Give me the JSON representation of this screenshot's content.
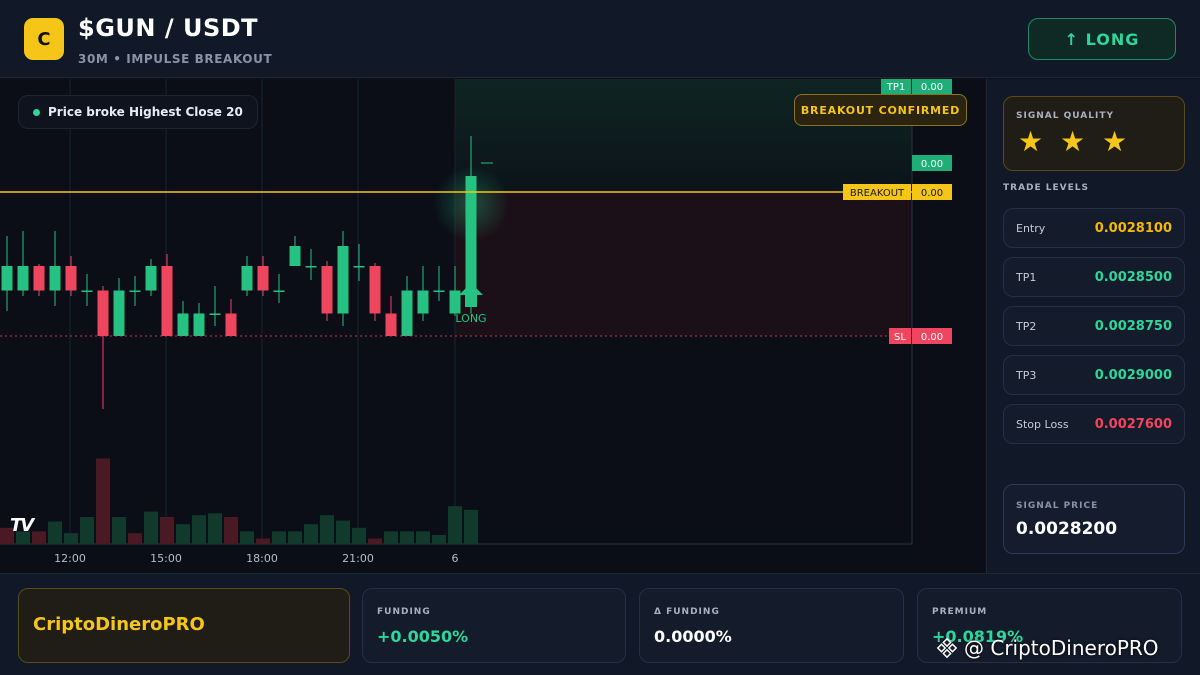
{
  "header": {
    "logo_letter": "C",
    "pair": "$GUN / USDT",
    "subtitle": "30M • IMPULSE BREAKOUT",
    "direction_button": "↑ LONG"
  },
  "chart": {
    "info_pill": "Price broke Highest Close 20",
    "badge": "BREAKOUT CONFIRMED",
    "signal_arrow_label": "LONG",
    "tv_logo": "TV",
    "price_tags": [
      {
        "label": "TP1",
        "value": "0.00"
      },
      {
        "label": "",
        "value": "0.00"
      },
      {
        "label": "BREAKOUT",
        "value": "0.00"
      },
      {
        "label": "SL",
        "value": "0.00"
      }
    ],
    "time_labels": [
      "12:00",
      "15:00",
      "18:00",
      "21:00",
      "6"
    ],
    "colors": {
      "up": "#26c281",
      "down": "#f0455f",
      "breakout": "#f5c518"
    }
  },
  "chart_data": {
    "type": "candlestick",
    "x_labels": [
      "12:00",
      "15:00",
      "18:00",
      "21:00",
      "6"
    ],
    "candles": [
      {
        "o": 0.455,
        "c": 0.7,
        "h": 1.0,
        "l": 0.25
      },
      {
        "o": 0.455,
        "c": 0.7,
        "h": 1.05,
        "l": 0.4
      },
      {
        "o": 0.7,
        "c": 0.455,
        "h": 0.72,
        "l": 0.4
      },
      {
        "o": 0.455,
        "c": 0.7,
        "h": 1.05,
        "l": 0.3
      },
      {
        "o": 0.7,
        "c": 0.455,
        "h": 0.8,
        "l": 0.4
      },
      {
        "o": 0.455,
        "c": 0.455,
        "h": 0.62,
        "l": 0.3
      },
      {
        "o": 0.455,
        "c": 0.0,
        "h": 0.5,
        "l": -0.73
      },
      {
        "o": 0.0,
        "c": 0.455,
        "h": 0.58,
        "l": 0.0
      },
      {
        "o": 0.455,
        "c": 0.455,
        "h": 0.6,
        "l": 0.3
      },
      {
        "o": 0.455,
        "c": 0.7,
        "h": 0.77,
        "l": 0.4
      },
      {
        "o": 0.7,
        "c": 0.0,
        "h": 0.82,
        "l": 0.0
      },
      {
        "o": 0.0,
        "c": 0.225,
        "h": 0.35,
        "l": 0.0
      },
      {
        "o": 0.0,
        "c": 0.225,
        "h": 0.33,
        "l": 0.0
      },
      {
        "o": 0.225,
        "c": 0.225,
        "h": 0.5,
        "l": 0.1
      },
      {
        "o": 0.225,
        "c": 0.0,
        "h": 0.37,
        "l": 0.0
      },
      {
        "o": 0.455,
        "c": 0.7,
        "h": 0.8,
        "l": 0.4
      },
      {
        "o": 0.7,
        "c": 0.455,
        "h": 0.8,
        "l": 0.4
      },
      {
        "o": 0.455,
        "c": 0.455,
        "h": 0.62,
        "l": 0.33
      },
      {
        "o": 0.7,
        "c": 0.9,
        "h": 1.0,
        "l": 0.7
      },
      {
        "o": 0.7,
        "c": 0.7,
        "h": 0.87,
        "l": 0.56
      },
      {
        "o": 0.7,
        "c": 0.225,
        "h": 0.75,
        "l": 0.15
      },
      {
        "o": 0.225,
        "c": 0.9,
        "h": 1.05,
        "l": 0.1
      },
      {
        "o": 0.7,
        "c": 0.7,
        "h": 0.92,
        "l": 0.55
      },
      {
        "o": 0.7,
        "c": 0.225,
        "h": 0.73,
        "l": 0.15
      },
      {
        "o": 0.225,
        "c": 0.0,
        "h": 0.4,
        "l": 0.0
      },
      {
        "o": 0.0,
        "c": 0.455,
        "h": 0.6,
        "l": 0.0
      },
      {
        "o": 0.225,
        "c": 0.455,
        "h": 0.7,
        "l": 0.15
      },
      {
        "o": 0.455,
        "c": 0.455,
        "h": 0.7,
        "l": 0.35
      },
      {
        "o": 0.225,
        "c": 0.455,
        "h": 0.7,
        "l": 0.2
      },
      {
        "o": 0.455,
        "c": 1.6,
        "h": 2.0,
        "l": 0.225
      }
    ],
    "volume": [
      0.18,
      0.14,
      0.14,
      0.25,
      0.12,
      0.3,
      0.95,
      0.3,
      0.12,
      0.36,
      0.3,
      0.22,
      0.32,
      0.34,
      0.3,
      0.14,
      0.06,
      0.14,
      0.14,
      0.22,
      0.32,
      0.26,
      0.18,
      0.06,
      0.14,
      0.14,
      0.14,
      0.1,
      0.42,
      0.38
    ],
    "volume_dir": [
      "down",
      "up",
      "down",
      "up",
      "up",
      "up",
      "down",
      "up",
      "down",
      "up",
      "down",
      "up",
      "up",
      "up",
      "down",
      "up",
      "down",
      "up",
      "up",
      "up",
      "up",
      "up",
      "up",
      "down",
      "up",
      "up",
      "up",
      "up",
      "up",
      "up"
    ]
  },
  "panel": {
    "quality_label": "SIGNAL QUALITY",
    "stars": "★ ★ ★",
    "trade_levels_title": "TRADE LEVELS",
    "levels": [
      {
        "label": "Entry",
        "value": "0.0028100",
        "color": "#f5b800"
      },
      {
        "label": "TP1",
        "value": "0.0028500",
        "color": "#2ed699"
      },
      {
        "label": "TP2",
        "value": "0.0028750",
        "color": "#2ed699"
      },
      {
        "label": "TP3",
        "value": "0.0029000",
        "color": "#2ed699"
      },
      {
        "label": "Stop Loss",
        "value": "0.0027600",
        "color": "#f0455f"
      }
    ],
    "signal_price_label": "SIGNAL PRICE",
    "signal_price_value": "0.0028200"
  },
  "footer": {
    "brand": "CriptoDineroPRO",
    "stats": [
      {
        "label": "FUNDING",
        "value": "+0.0050%",
        "color": "#2ed699"
      },
      {
        "label": "Δ FUNDING",
        "value": "0.0000%",
        "color": "#ffffff"
      },
      {
        "label": "PREMIUM",
        "value": "+0.0819%",
        "color": "#2ed699"
      }
    ],
    "watermark": "@ CriptoDineroPRO"
  }
}
